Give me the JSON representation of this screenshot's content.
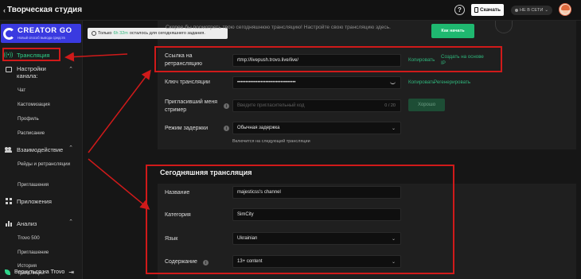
{
  "topbar": {
    "brand": "Творческая студия",
    "brand_caret": "‹",
    "help_glyph": "?",
    "download_label": "Скачать",
    "status_label": "НЕ В СЕТИ",
    "status_caret": "⌄"
  },
  "sidebar": {
    "logo_title": "CREATOR GO",
    "logo_subtitle": "Новый способ вывода средств",
    "items": [
      {
        "label": "Трансляция",
        "icon": "broadcast-icon"
      },
      {
        "label": "Настройки канала:",
        "icon": "settings-box-icon"
      },
      {
        "label": "Взаимодействие",
        "icon": "people-icon"
      },
      {
        "label": "Приложения",
        "icon": "apps-icon"
      },
      {
        "label": "Анализ",
        "icon": "analytics-icon"
      }
    ],
    "settings_sub": [
      "Чат",
      "Кастомизация",
      "Профиль",
      "Расписание"
    ],
    "interaction_sub": [
      "Рейды и ретрансляции",
      "Приглашения"
    ],
    "analysis_sub": [
      "Trovo 500",
      "Приглашение",
      "История трансляций"
    ],
    "back_label": "Вернуться на Trovo",
    "caret_up": "⌃"
  },
  "banner": {
    "prefix": "Только",
    "time": "6h 32m",
    "suffix": "осталось для сегодняшнего задания."
  },
  "stream_settings": {
    "hint": "Скорее бы посмотреть твою сегодняшнюю трансляцию! Настройте свою трансляцию здесь.",
    "green_tag": "Как начать",
    "url_label": "Ссылка на ретрансляцию",
    "url_value": "rtmp://livepush.trovo.live/live/",
    "copy": "Копировать",
    "create_based": "Создать на основе IP",
    "key_label": "Ключ трансляции",
    "key_value": "•••••••••••••••••••••••••••••••••••",
    "regenerate": "Регенерировать",
    "inviter_label": "Пригласивший меня стример",
    "inviter_placeholder": "Введите пригласительный код",
    "inviter_count": "0 / 20",
    "apply": "Хорошо",
    "delay_label": "Режим задержки",
    "delay_value": "Обычная задержка",
    "delay_note": "Включится на следующей трансляции",
    "info_glyph": "i",
    "dropdown_caret": "⌄"
  },
  "today": {
    "title": "Сегодняшняя трансляция",
    "name_label": "Название",
    "name_value": "majesticss's channel",
    "category_label": "Категория",
    "category_value": "SimCity",
    "language_label": "Язык",
    "language_value": "Ukrainian",
    "content_label": "Содержание",
    "content_value": "13+ content"
  },
  "colors": {
    "accent": "#2fd48a",
    "annotation": "#d01a1a",
    "logo_bg": "#3a3ae0"
  }
}
